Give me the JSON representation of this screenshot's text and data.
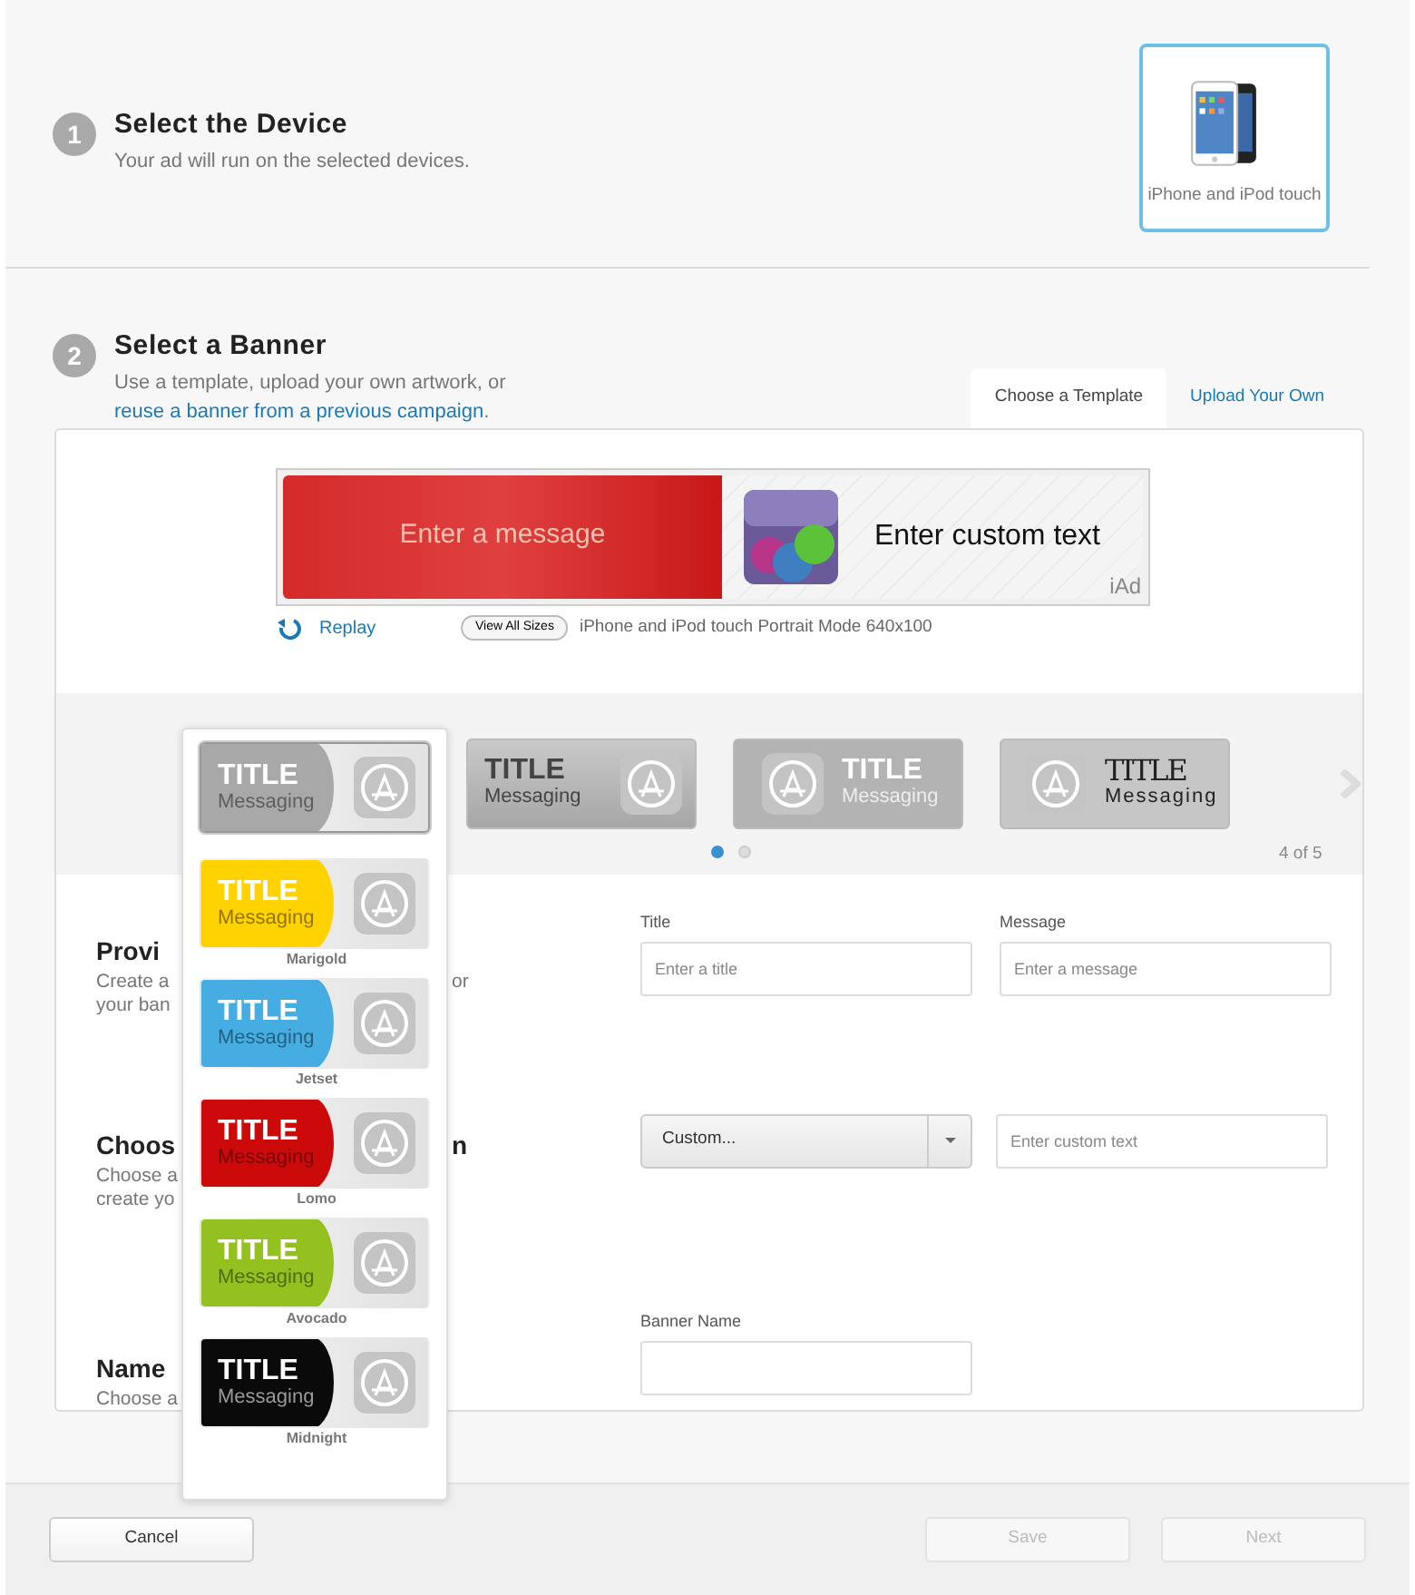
{
  "step1": {
    "number": "1",
    "title": "Select the Device",
    "subtitle": "Your ad will run on the selected devices."
  },
  "device": {
    "label": "iPhone and iPod touch",
    "selected": true
  },
  "step2": {
    "number": "2",
    "title": "Select a Banner",
    "subtitle": "Use a template, upload your own artwork, or ",
    "link": "reuse a banner from a previous campaign",
    "after_link": "."
  },
  "tabs": [
    {
      "label": "Choose a Template",
      "selected": true
    },
    {
      "label": "Upload Your Own",
      "selected": false
    }
  ],
  "preview": {
    "message": "Enter a message",
    "custom_text": "Enter custom text",
    "badge": "iAd",
    "replay": "Replay",
    "view_all": "View All Sizes",
    "size_label": "iPhone and iPod touch Portrait Mode 640x100"
  },
  "carousel": {
    "thumbnails": [
      {
        "kind": "gradient",
        "title": "TITLE",
        "messaging": "Messaging"
      },
      {
        "kind": "icon-first",
        "title": "TITLE",
        "messaging": "Messaging"
      },
      {
        "kind": "condensed",
        "title": "TITLE",
        "messaging": "Messaging"
      }
    ],
    "pages": [
      {
        "selected": true
      },
      {
        "selected": false
      }
    ],
    "counter": "4 of 5"
  },
  "template_menu": [
    {
      "title": "TITLE",
      "messaging": "Messaging",
      "color": "#a8a8a8",
      "selected": true
    },
    {
      "title": "TITLE",
      "messaging": "Messaging",
      "color": "#ffd200",
      "name": "Marigold",
      "selected": false
    },
    {
      "title": "TITLE",
      "messaging": "Messaging",
      "color": "#45ade2",
      "name": "Jetset",
      "selected": false
    },
    {
      "title": "TITLE",
      "messaging": "Messaging",
      "color": "#cc0a0a",
      "name": "Lomo",
      "selected": false
    },
    {
      "title": "TITLE",
      "messaging": "Messaging",
      "color": "#94c11f",
      "name": "Avocado",
      "selected": false
    },
    {
      "title": "TITLE",
      "messaging": "Messaging",
      "color": "#0a0a0a",
      "name": "Midnight",
      "selected": false
    }
  ],
  "form_sections": [
    {
      "heading": [
        "Provi"
      ],
      "lines": [
        [
          "Create a",
          "or"
        ],
        [
          "your ban"
        ]
      ]
    },
    {
      "heading": [
        "Choos",
        "n"
      ],
      "lines": [
        [
          "Choose a"
        ],
        [
          "create yo"
        ]
      ]
    },
    {
      "heading": [
        "Name"
      ],
      "lines": [
        [
          "Choose a"
        ]
      ]
    }
  ],
  "fields": {
    "title": {
      "label": "Title",
      "placeholder": "Enter a title"
    },
    "message": {
      "label": "Message",
      "placeholder": "Enter a message"
    },
    "select": {
      "value": "Custom..."
    },
    "custom_text": {
      "placeholder": "Enter custom text"
    },
    "banner_name": {
      "label": "Banner Name"
    }
  },
  "buttons": [
    {
      "label": "Cancel",
      "disabled": false
    },
    {
      "label": "Save",
      "disabled": true
    },
    {
      "label": "Next",
      "disabled": true
    }
  ]
}
